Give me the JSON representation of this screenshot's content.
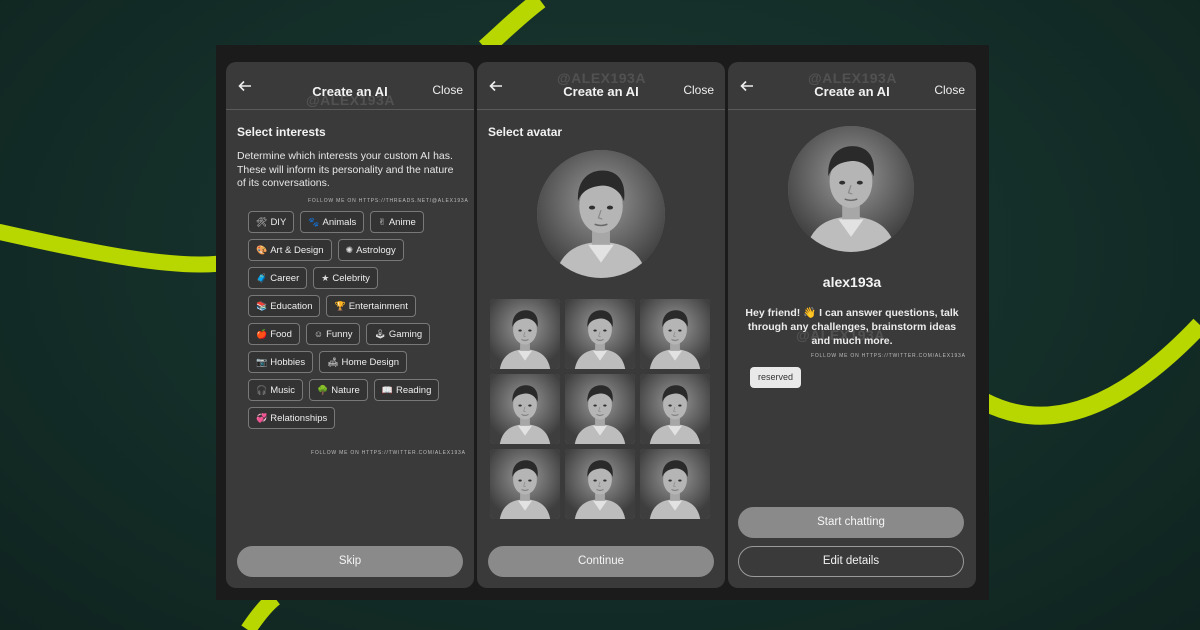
{
  "colors": {
    "background": "#15302a",
    "accent_swoosh": "#b8d600",
    "panel": "#3a3a3a",
    "frame": "#1b1b1b"
  },
  "watermark": "@ALEX193A",
  "screens": {
    "interests": {
      "back_icon": "arrow-left-icon",
      "title": "Create an AI",
      "close_label": "Close",
      "section_title": "Select interests",
      "description": "Determine which interests your custom AI has. These will inform its personality and the nature of its conversations.",
      "follow_note": "FOLLOW ME ON HTTPS://THREADS.NET/@ALEX193A",
      "follow_note_bottom": "FOLLOW ME ON HTTPS://TWITTER.COM/ALEX193A",
      "interests": [
        {
          "label": "DIY",
          "icon": "🛠"
        },
        {
          "label": "Animals",
          "icon": "🐾"
        },
        {
          "label": "Anime",
          "icon": "✌"
        },
        {
          "label": "Art & Design",
          "icon": "🎨"
        },
        {
          "label": "Astrology",
          "icon": "✺"
        },
        {
          "label": "Career",
          "icon": "🧳"
        },
        {
          "label": "Celebrity",
          "icon": "★"
        },
        {
          "label": "Education",
          "icon": "📚"
        },
        {
          "label": "Entertainment",
          "icon": "🏆"
        },
        {
          "label": "Food",
          "icon": "🍎"
        },
        {
          "label": "Funny",
          "icon": "☺"
        },
        {
          "label": "Gaming",
          "icon": "🕹"
        },
        {
          "label": "Hobbies",
          "icon": "📷"
        },
        {
          "label": "Home Design",
          "icon": "🛋"
        },
        {
          "label": "Music",
          "icon": "🎧"
        },
        {
          "label": "Nature",
          "icon": "🌳"
        },
        {
          "label": "Reading",
          "icon": "📖"
        },
        {
          "label": "Relationships",
          "icon": "💞"
        }
      ],
      "skip_label": "Skip"
    },
    "avatar": {
      "title": "Create an AI",
      "close_label": "Close",
      "section_title": "Select avatar",
      "avatar_options_count": 9,
      "continue_label": "Continue"
    },
    "profile": {
      "title": "Create an AI",
      "close_label": "Close",
      "name": "alex193a",
      "bio": "Hey friend! 👋 I can answer questions, talk through any challenges, brainstorm ideas and much more.",
      "follow_note": "FOLLOW ME ON HTTPS://TWITTER.COM/ALEX193A",
      "tag": "reserved",
      "start_label": "Start chatting",
      "edit_label": "Edit details"
    }
  }
}
